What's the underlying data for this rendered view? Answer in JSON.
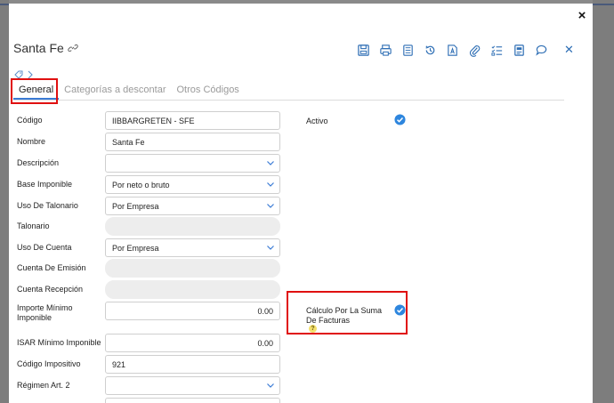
{
  "window": {
    "title": "Santa Fe",
    "close_glyph": "×"
  },
  "toolbar": {
    "icons": [
      "save-icon",
      "print-icon",
      "document-icon",
      "history-icon",
      "pdf-icon",
      "attach-icon",
      "checklist-icon",
      "notes-icon",
      "comment-icon"
    ],
    "close_glyph": "✕"
  },
  "breadcrumb": {
    "items": [
      "tag-icon",
      "chevron-right-icon"
    ]
  },
  "tabs": [
    {
      "label": "General",
      "active": true
    },
    {
      "label": "Categorías a descontar",
      "active": false
    },
    {
      "label": "Otros Códigos",
      "active": false
    }
  ],
  "form": {
    "codigo": {
      "label": "Código",
      "value": "IIBBARGRETEN - SFE"
    },
    "nombre": {
      "label": "Nombre",
      "value": "Santa Fe"
    },
    "descripcion": {
      "label": "Descripción",
      "value": ""
    },
    "base_imponible": {
      "label": "Base Imponible",
      "value": "Por neto o bruto"
    },
    "uso_talonario": {
      "label": "Uso De Talonario",
      "value": "Por Empresa"
    },
    "talonario": {
      "label": "Talonario",
      "value": ""
    },
    "uso_cuenta": {
      "label": "Uso De Cuenta",
      "value": "Por Empresa"
    },
    "cuenta_emision": {
      "label": "Cuenta De Emisión",
      "value": ""
    },
    "cuenta_recepcion": {
      "label": "Cuenta Recepción",
      "value": ""
    },
    "importe_minimo": {
      "label": "Importe Mínimo Imponible",
      "value": "0.00"
    },
    "isar_minimo": {
      "label": "ISAR Mínimo Imponible",
      "value": "0.00"
    },
    "codigo_impositivo": {
      "label": "Código Impositivo",
      "value": "921"
    },
    "regimen": {
      "label": "Régimen Art. 2",
      "value": ""
    },
    "activo": {
      "label": "Activo",
      "checked": true
    },
    "calculo_suma": {
      "label": "Cálculo Por La Suma De Facturas",
      "checked": true,
      "help": "?"
    }
  },
  "colors": {
    "accent": "#3a7bd5",
    "highlight": "#e01010",
    "check": "#2e86de"
  }
}
